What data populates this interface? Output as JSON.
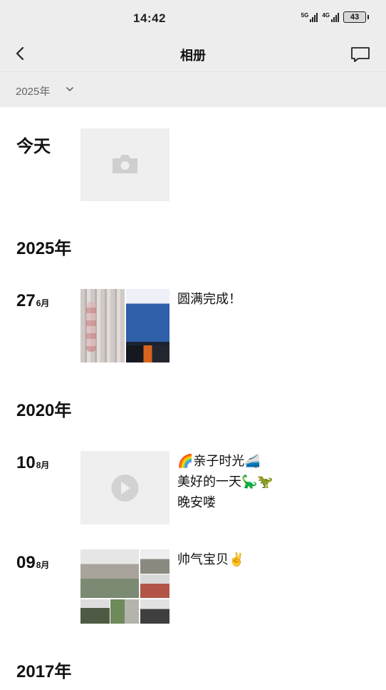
{
  "status_bar": {
    "time": "14:42",
    "signal_1_label": "5G",
    "signal_2_label": "4G",
    "battery": "43"
  },
  "header": {
    "title": "相册",
    "back_icon": "chevron-left-icon",
    "message_icon": "chat-bubble-icon"
  },
  "filter": {
    "year_label": "2025年"
  },
  "today": {
    "label": "今天",
    "placeholder_icon": "camera-icon"
  },
  "sections": [
    {
      "year": "2025年",
      "posts": [
        {
          "day": "27",
          "month": "6月",
          "caption_lines": [
            "圆满完成！"
          ]
        }
      ]
    },
    {
      "year": "2020年",
      "posts": [
        {
          "day": "10",
          "month": "8月",
          "caption_lines": [
            "🌈亲子时光🚄",
            "美好的一天🦕🦖",
            "晚安喽"
          ]
        },
        {
          "day": "09",
          "month": "8月",
          "caption_lines": [
            "帅气宝贝✌️"
          ]
        }
      ]
    },
    {
      "year": "2017年",
      "posts": []
    }
  ],
  "colors": {
    "header_bg": "#ededed",
    "tile_bg": "#efefef",
    "icon_grey": "#d0d0d0"
  }
}
